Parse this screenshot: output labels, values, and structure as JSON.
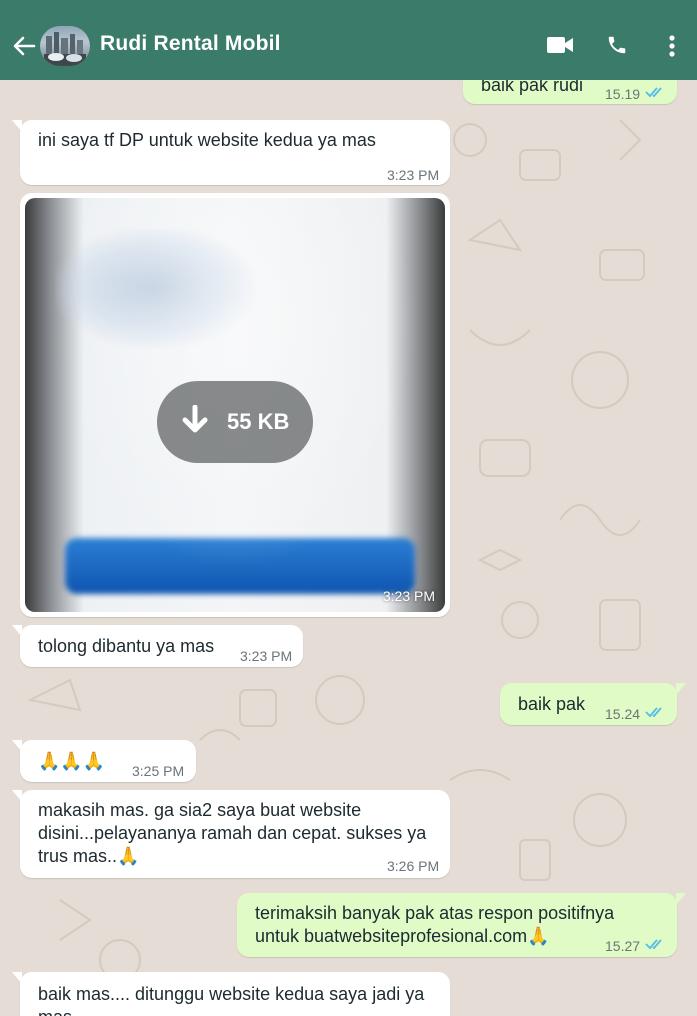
{
  "header": {
    "title": "Rudi Rental Mobil",
    "back_icon": "arrow-left-icon",
    "video_icon": "video-camera-icon",
    "call_icon": "phone-icon",
    "menu_icon": "more-vertical-icon",
    "color": "#3b7b69"
  },
  "messages": [
    {
      "dir": "out",
      "text": "baik pak rudi",
      "time": "15.19",
      "status": "read"
    },
    {
      "dir": "in",
      "text": "ini saya tf DP untuk website kedua ya mas",
      "time": "3:23 PM"
    },
    {
      "dir": "in",
      "type": "image",
      "download_label": "55 KB",
      "time": "3:23 PM"
    },
    {
      "dir": "in",
      "text": "tolong dibantu ya mas",
      "time": "3:23 PM"
    },
    {
      "dir": "out",
      "text": "baik pak",
      "time": "15.24",
      "status": "read"
    },
    {
      "dir": "in",
      "text": "🙏🙏🙏",
      "time": "3:25 PM"
    },
    {
      "dir": "in",
      "lines": [
        "makasih mas. ga sia2 saya buat website",
        "disini...pelayananya ramah dan cepat. sukses ya",
        "trus mas..🙏"
      ],
      "time": "3:26 PM"
    },
    {
      "dir": "out",
      "lines": [
        "terimaksih banyak pak atas respon positifnya",
        "untuk buatwebsiteprofesional.com🙏"
      ],
      "time": "15.27",
      "status": "read"
    },
    {
      "dir": "in",
      "lines": [
        "baik mas.... ditunggu website kedua saya jadi ya",
        "mas"
      ]
    }
  ],
  "colors": {
    "chat_bg": "#e5ddd5",
    "incoming": "#ffffff",
    "outgoing": "#e1fbc7",
    "read_ticks": "#53bdeb"
  }
}
